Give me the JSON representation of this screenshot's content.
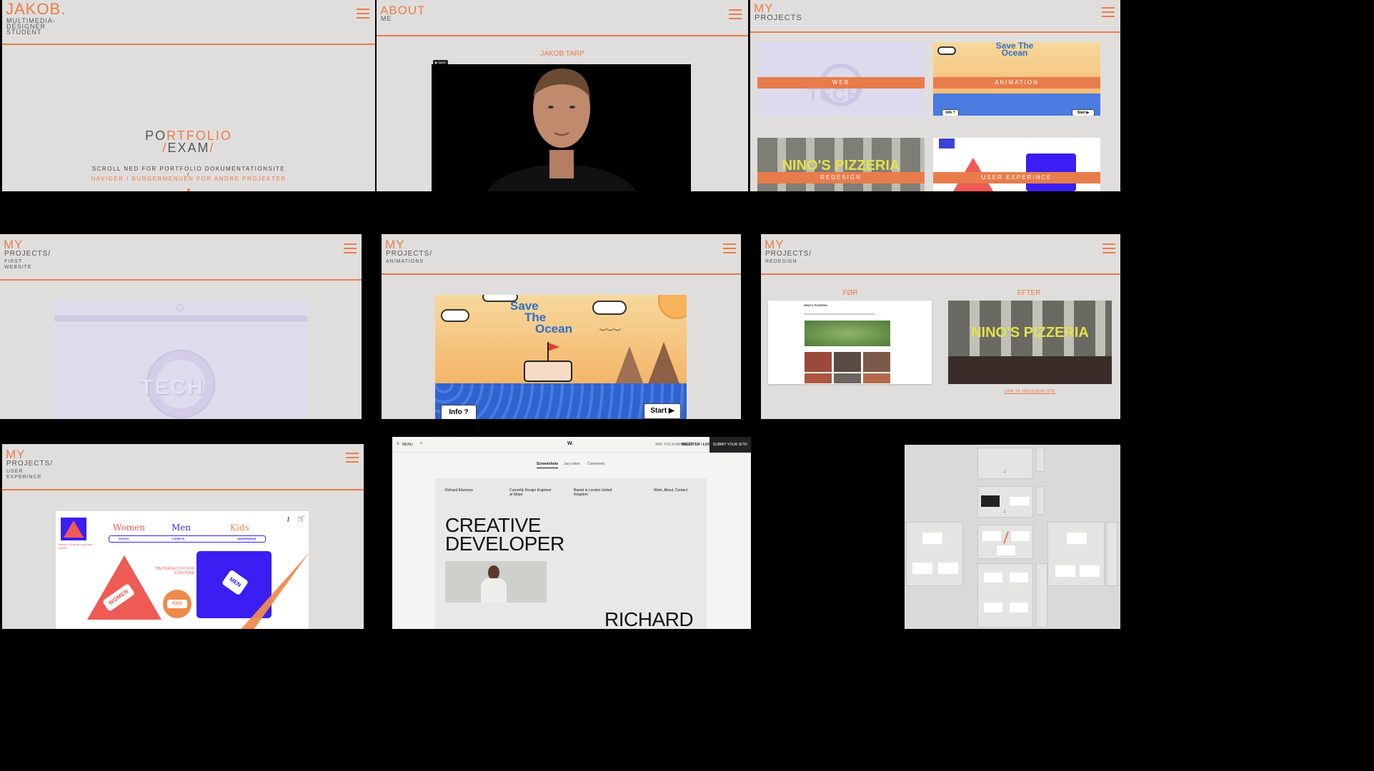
{
  "colors": {
    "accent": "#e97c4b",
    "panel_bg": "#e0dedc",
    "dark": "#555555"
  },
  "p1": {
    "logo": "JAKOB.",
    "subtitle_lines": [
      "MULTIMEDIA-",
      "DESIGNER",
      "STUDENT"
    ],
    "title_a_dark": "PO",
    "title_a_orange": "RTFOLIO",
    "title_b_slash1": "/",
    "title_b_word": "EXAM",
    "title_b_slash2": "/",
    "scroll_text": "SCROLL NED FOR PORTFOLIO DOKUMENTATIONSITE",
    "sep": "/",
    "nav_text": "NAVIGER I BURGERMENUEN FOR ANDRE PROJEKTER"
  },
  "p2": {
    "title": "ABOUT",
    "sub": "ME",
    "name": "JAKOB TARP",
    "badge": "▶ SAVE"
  },
  "p3": {
    "title": "MY",
    "sub": "PROJECTS",
    "tiles": [
      "WEB",
      "ANIMATION",
      "REDESIGN",
      "USER EXPERINCE"
    ],
    "tech_word": "TECH",
    "save_word": "Save The Ocean",
    "pizzeria": "NINO'S PIZZERIA",
    "info_btn": "Info ?",
    "start_btn": "Start ▶"
  },
  "p4": {
    "title": "MY",
    "sub1": "PROJECTS/",
    "sub2_lines": [
      "FIRST",
      "WEBSITE"
    ],
    "tech_word": "TECH"
  },
  "p5": {
    "title": "MY",
    "sub1": "PROJECTS/",
    "sub2": "ANIMATIONS",
    "save_lines": [
      "Save",
      "The",
      "Ocean"
    ],
    "info_btn": "Info ?",
    "start_btn": "Start ▶"
  },
  "p6": {
    "title": "MY",
    "sub1": "PROJECTS/",
    "sub2": "REDESIGN",
    "before": "FØR",
    "after": "EFTER",
    "old_site_name": "NINO'S PIZZERIA",
    "pizzeria": "NINO'S PIZZERIA",
    "link": "LINK TIL REDESIGN SITE"
  },
  "p7": {
    "title": "MY",
    "sub1": "PROJECTS/",
    "sub2_lines": [
      "USER",
      "EXPERINCE"
    ],
    "nav": [
      "Women",
      "Men",
      "Kids"
    ],
    "subnav": [
      "SOCKS",
      "T-SHIRTS",
      "UNDERWEAR"
    ],
    "tagline": "Made to fit perfect and last forever",
    "perfect_fit": "THE PERFECT FIT FOR EVERYONE",
    "women": "WOMEN",
    "men": "MEN",
    "kids": "KIDS"
  },
  "p8": {
    "menu": "MENU",
    "logo": "W.",
    "are_you": "ARE YOU A MEMBER?",
    "register": "REGISTER / LOG IN",
    "submit": "SUBMIT YOUR SITE!",
    "tabs": [
      "Screenshots",
      "Jury votes",
      "Comments"
    ],
    "info": [
      "Richard Ekwonye",
      "Currently Design Engineer at Stripe",
      "Based in London United Kingdom",
      "Work, About, Contact"
    ],
    "headline_lines": [
      "CREATIVE",
      "DEVELOPER"
    ],
    "bottom_name": "RICHARD"
  }
}
